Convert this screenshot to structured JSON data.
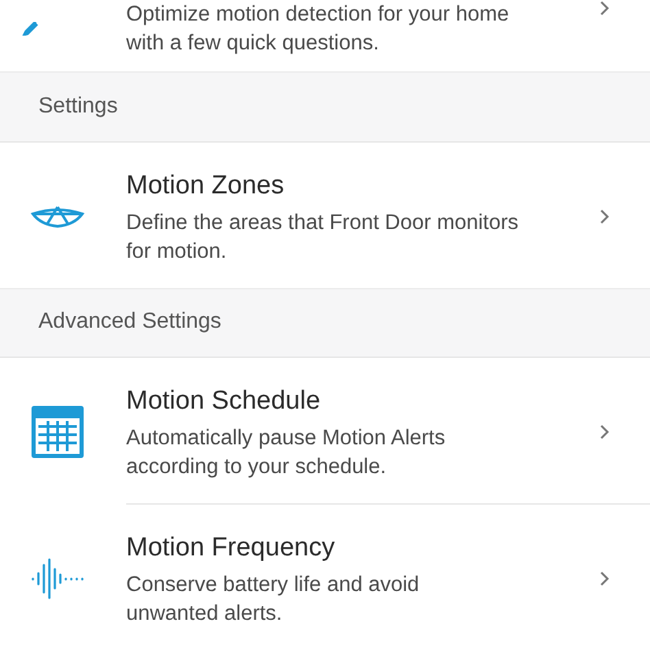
{
  "sections": [
    {
      "items": [
        {
          "kind": "pencil",
          "description": [
            "Optimize motion detection for your home",
            "with a few quick questions."
          ]
        }
      ]
    },
    {
      "header": "Settings",
      "items": [
        {
          "kind": "zones",
          "title": "Motion Zones",
          "description": [
            "Define the areas that Front Door monitors",
            "for motion."
          ]
        }
      ]
    },
    {
      "header": "Advanced Settings",
      "items": [
        {
          "kind": "calendar",
          "title": "Motion Schedule",
          "description": [
            "Automatically pause Motion Alerts",
            "according to your schedule."
          ]
        },
        {
          "kind": "waveform",
          "title": "Motion Frequency",
          "description": [
            "Conserve battery life and avoid",
            "unwanted alerts."
          ]
        }
      ]
    }
  ]
}
